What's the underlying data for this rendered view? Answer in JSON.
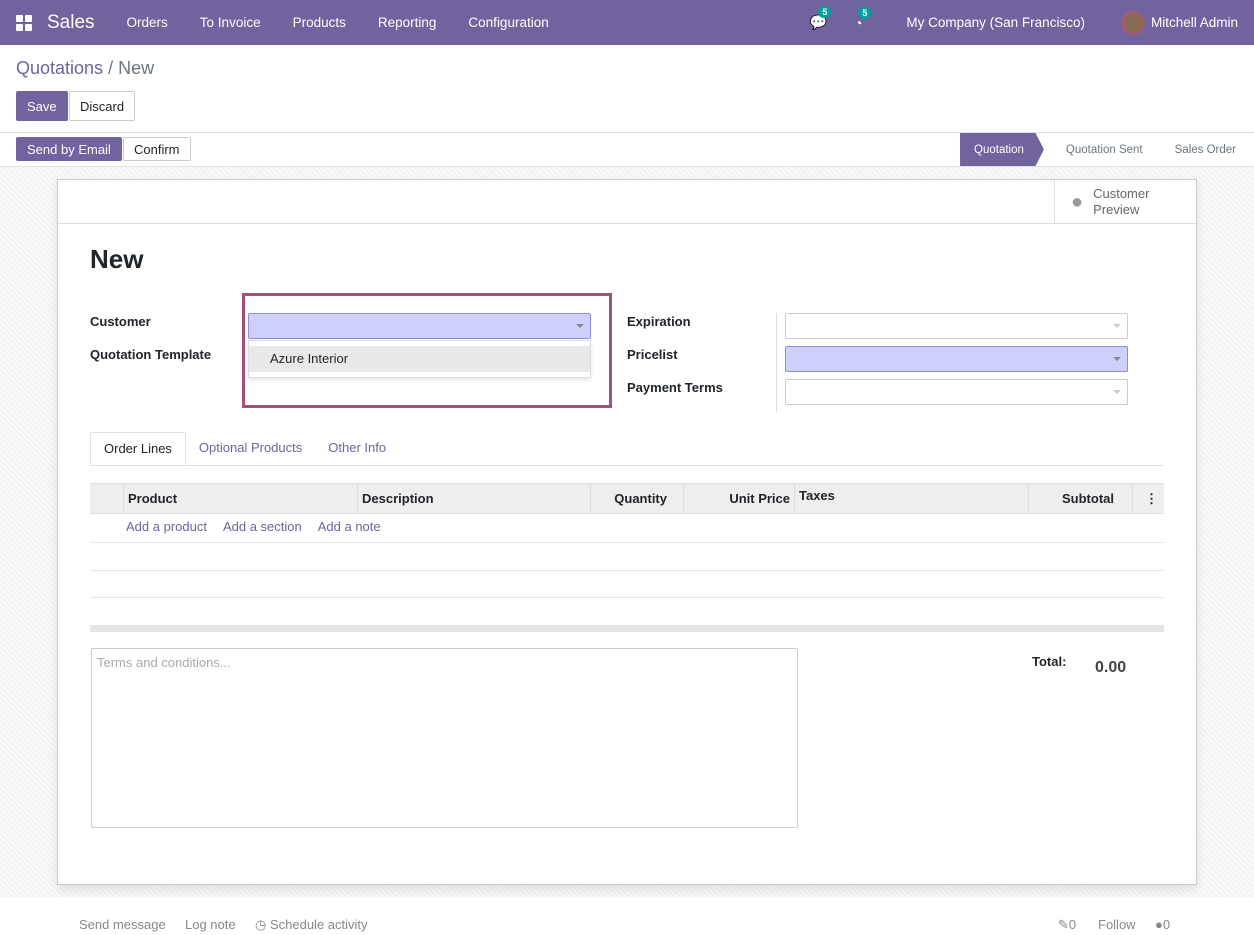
{
  "nav": {
    "brand": "Sales",
    "menu": [
      "Orders",
      "To Invoice",
      "Products",
      "Reporting",
      "Configuration"
    ],
    "messages_count": "5",
    "activities_count": "5",
    "company": "My Company (San Francisco)",
    "user": "Mitchell Admin"
  },
  "breadcrumb": {
    "parent": "Quotations",
    "separator": "/",
    "current": "New"
  },
  "buttons": {
    "save": "Save",
    "discard": "Discard",
    "send_email": "Send by Email",
    "confirm": "Confirm"
  },
  "stages": [
    "Quotation",
    "Quotation Sent",
    "Sales Order"
  ],
  "sheet": {
    "customer_preview": "Customer Preview",
    "title": "New",
    "fields": {
      "customer": "Customer",
      "template": "Quotation Template",
      "expiration": "Expiration",
      "pricelist": "Pricelist",
      "payment_terms": "Payment Terms"
    },
    "dropdown_option": "Azure Interior",
    "tabs": [
      "Order Lines",
      "Optional Products",
      "Other Info"
    ],
    "columns": [
      "Product",
      "Description",
      "Quantity",
      "Unit Price",
      "Taxes",
      "Subtotal"
    ],
    "add_links": [
      "Add a product",
      "Add a section",
      "Add a note"
    ],
    "terms_placeholder": "Terms and conditions...",
    "total_label": "Total:",
    "total_value": "0.00"
  },
  "chatter": {
    "send_message": "Send message",
    "log_note": "Log note",
    "schedule": "Schedule activity",
    "attachments": "0",
    "follow": "Follow",
    "followers": "0"
  }
}
